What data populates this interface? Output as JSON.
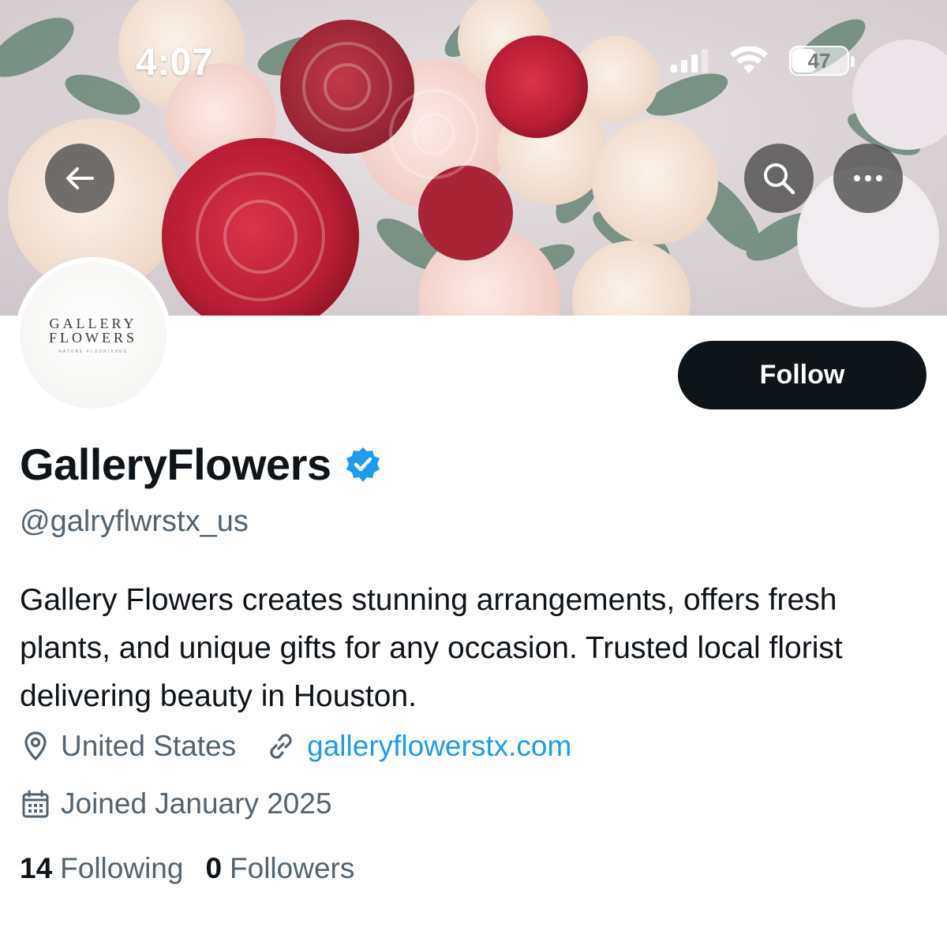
{
  "status_bar": {
    "time": "4:07",
    "battery": "47",
    "battery_level": 0.47,
    "signal_icon": "cellular-signal-icon",
    "wifi_icon": "wifi-icon"
  },
  "header": {
    "back_icon": "back-arrow-icon",
    "search_icon": "search-icon",
    "more_icon": "more-options-icon"
  },
  "avatar": {
    "logo_line1": "GALLERY",
    "logo_line2": "FLOWERS",
    "logo_tagline": "NATURE FLOURISHES"
  },
  "actions": {
    "follow_label": "Follow"
  },
  "profile": {
    "display_name": "GalleryFlowers",
    "verified": true,
    "handle": "@galryflwrstx_us",
    "bio": "Gallery Flowers creates stunning arrangements, offers fresh plants, and unique gifts for any occasion. Trusted local florist delivering beauty in Houston.",
    "location": "United States",
    "website": "galleryflowerstx.com",
    "joined": "Joined January 2025",
    "following_count": "14",
    "following_label": "Following",
    "followers_count": "0",
    "followers_label": "Followers"
  },
  "colors": {
    "primary_text": "#0f1419",
    "secondary_text": "#536471",
    "link": "#1d9bf0",
    "verified_badge": "#1d9bf0",
    "button_bg": "#0f1419"
  }
}
